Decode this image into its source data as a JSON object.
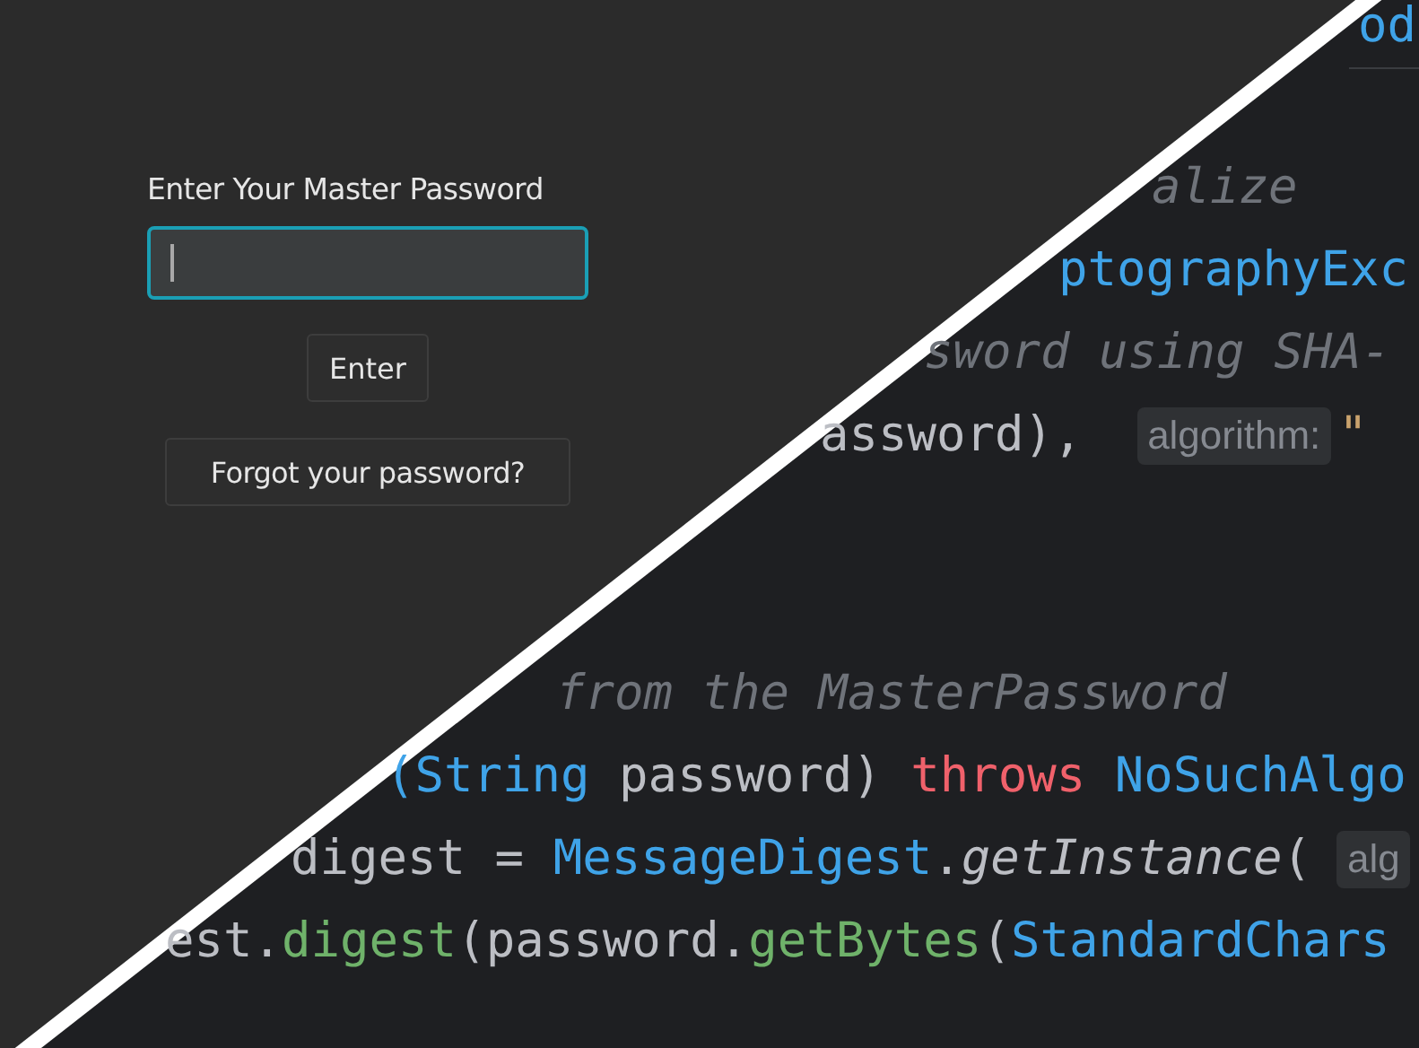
{
  "login": {
    "prompt": "Enter Your Master Password",
    "password_field": {
      "focused": true
    },
    "enter_button": "Enter",
    "forgot_button": "Forgot your password?"
  },
  "code_lines": [
    {
      "tokens": [
        {
          "kind": "type",
          "text": "od"
        }
      ]
    },
    {
      "tokens": [
        {
          "kind": "comment",
          "text": "alize"
        }
      ]
    },
    {
      "tokens": [
        {
          "kind": "type",
          "text": "ptographyExc"
        }
      ]
    },
    {
      "tokens": [
        {
          "kind": "comment",
          "text": "sword using SHA-"
        }
      ]
    },
    {
      "tokens": [
        {
          "kind": "plain",
          "text": "assword), "
        },
        {
          "kind": "inlay",
          "text": "algorithm:"
        },
        {
          "kind": "string",
          "text": "\""
        }
      ]
    },
    {
      "tokens": [
        {
          "kind": "comment",
          "text": "from the MasterPassword"
        }
      ]
    },
    {
      "tokens": [
        {
          "kind": "type",
          "text": "(String"
        },
        {
          "kind": "plain",
          "text": " password) "
        },
        {
          "kind": "keyword",
          "text": "throws"
        },
        {
          "kind": "type",
          "text": "NoSuchAlgo"
        }
      ]
    },
    {
      "tokens": [
        {
          "kind": "plain",
          "text": "digest = "
        },
        {
          "kind": "type",
          "text": "MessageDigest"
        },
        {
          "kind": "plain",
          "text": "."
        },
        {
          "kind": "static",
          "text": "getInstance"
        },
        {
          "kind": "plain",
          "text": "("
        },
        {
          "kind": "inlay",
          "text": "alg"
        }
      ]
    },
    {
      "tokens": [
        {
          "kind": "plain",
          "text": "est."
        },
        {
          "kind": "method",
          "text": "digest"
        },
        {
          "kind": "plain",
          "text": "(password."
        },
        {
          "kind": "method",
          "text": "getBytes"
        },
        {
          "kind": "plain",
          "text": "("
        },
        {
          "kind": "type",
          "text": "StandardChars"
        }
      ]
    }
  ]
}
